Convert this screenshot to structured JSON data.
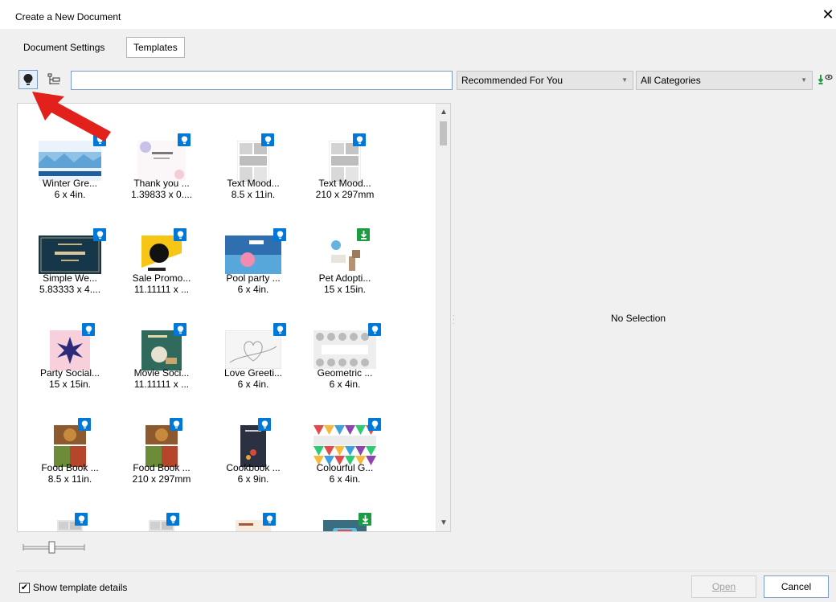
{
  "window": {
    "title": "Create a New Document",
    "close_glyph": "✕"
  },
  "tabs": [
    {
      "label": "Document Settings"
    },
    {
      "label": "Templates"
    }
  ],
  "toolbar": {
    "search_value": "",
    "recommended_dropdown": "Recommended For You",
    "categories_dropdown": "All Categories",
    "dropdown_arrow": "▼"
  },
  "templates": [
    {
      "name": "Winter Gre...",
      "size": "6 x 4in.",
      "badge": "recommended",
      "thumb": "winter"
    },
    {
      "name": "Thank you ...",
      "size": "1.39833 x 0....",
      "badge": "recommended",
      "thumb": "thankyou"
    },
    {
      "name": "Text Mood...",
      "size": "8.5 x 11in.",
      "badge": "recommended",
      "thumb": "mood"
    },
    {
      "name": "Text Mood...",
      "size": "210 x 297mm",
      "badge": "recommended",
      "thumb": "mood"
    },
    {
      "name": "Simple We...",
      "size": "5.83333 x 4....",
      "badge": "recommended",
      "thumb": "wedding"
    },
    {
      "name": "Sale Promo...",
      "size": "11.11111 x ...",
      "badge": "recommended",
      "thumb": "sale"
    },
    {
      "name": "Pool party ...",
      "size": "6 x 4in.",
      "badge": "recommended",
      "thumb": "pool"
    },
    {
      "name": "Pet Adopti...",
      "size": "15 x 15in.",
      "badge": "download",
      "thumb": "pet"
    },
    {
      "name": "Party Social...",
      "size": "15 x 15in.",
      "badge": "recommended",
      "thumb": "party"
    },
    {
      "name": "Movie Soci...",
      "size": "11.11111 x ...",
      "badge": "recommended",
      "thumb": "movie"
    },
    {
      "name": "Love Greeti...",
      "size": "6 x 4in.",
      "badge": "recommended",
      "thumb": "love"
    },
    {
      "name": "Geometric ...",
      "size": "6 x 4in.",
      "badge": "recommended",
      "thumb": "geometric"
    },
    {
      "name": "Food Book ...",
      "size": "8.5 x 11in.",
      "badge": "recommended",
      "thumb": "food"
    },
    {
      "name": "Food Book ...",
      "size": "210 x 297mm",
      "badge": "recommended",
      "thumb": "food"
    },
    {
      "name": "Cookbook ...",
      "size": "6 x 9in.",
      "badge": "recommended",
      "thumb": "cookbook"
    },
    {
      "name": "Colourful G...",
      "size": "6 x 4in.",
      "badge": "recommended",
      "thumb": "colourful"
    },
    {
      "name": "",
      "size": "",
      "badge": "recommended",
      "thumb": "gray"
    },
    {
      "name": "",
      "size": "",
      "badge": "recommended",
      "thumb": "gray"
    },
    {
      "name": "",
      "size": "",
      "badge": "recommended",
      "thumb": "coffee"
    },
    {
      "name": "",
      "size": "",
      "badge": "download",
      "thumb": "bbq"
    }
  ],
  "details": {
    "no_selection": "No Selection"
  },
  "footer": {
    "show_details_label": "Show template details",
    "show_details_checked": true,
    "check_glyph": "✔",
    "open_label": "Open",
    "cancel_label": "Cancel"
  },
  "colors": {
    "accent_blue": "#0078d7",
    "download_green": "#1e9c44",
    "arrow_red": "#e2211c"
  }
}
